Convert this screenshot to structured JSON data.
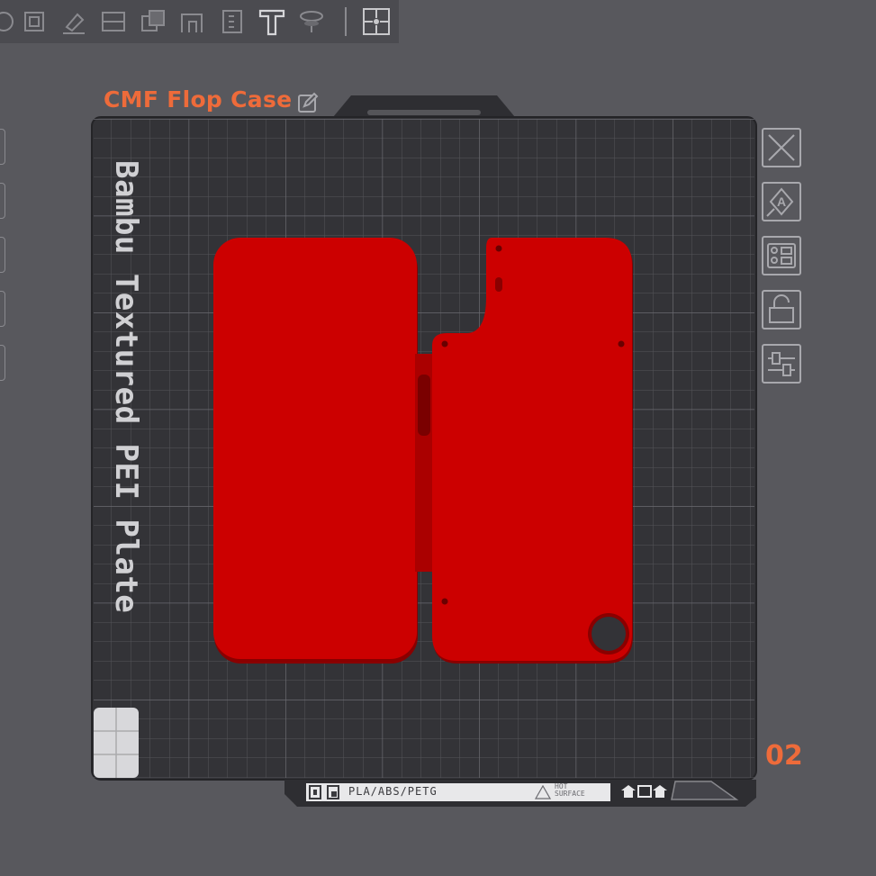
{
  "toolbar": {
    "icons": [
      "move-icon",
      "scale-icon",
      "paint-icon",
      "cut-icon",
      "boolean-icon",
      "support-paint-icon",
      "measure-icon",
      "text-icon",
      "assembly-icon",
      "puzzle-icon"
    ]
  },
  "plate": {
    "title": "CMF Flop Case",
    "bed_name": "Bambu Textured PEI Plate",
    "number": "02",
    "filament_label": "PLA/ABS/PETG",
    "hot_surface_label": "HOT\nSURFACE"
  },
  "side_buttons": [
    "close-plate-icon",
    "auto-orient-icon",
    "arrange-icon",
    "lock-icon",
    "plate-settings-icon"
  ],
  "colors": {
    "model": "#cc0000",
    "accent": "#ee6b3a",
    "bed": "#3a3a3e"
  }
}
